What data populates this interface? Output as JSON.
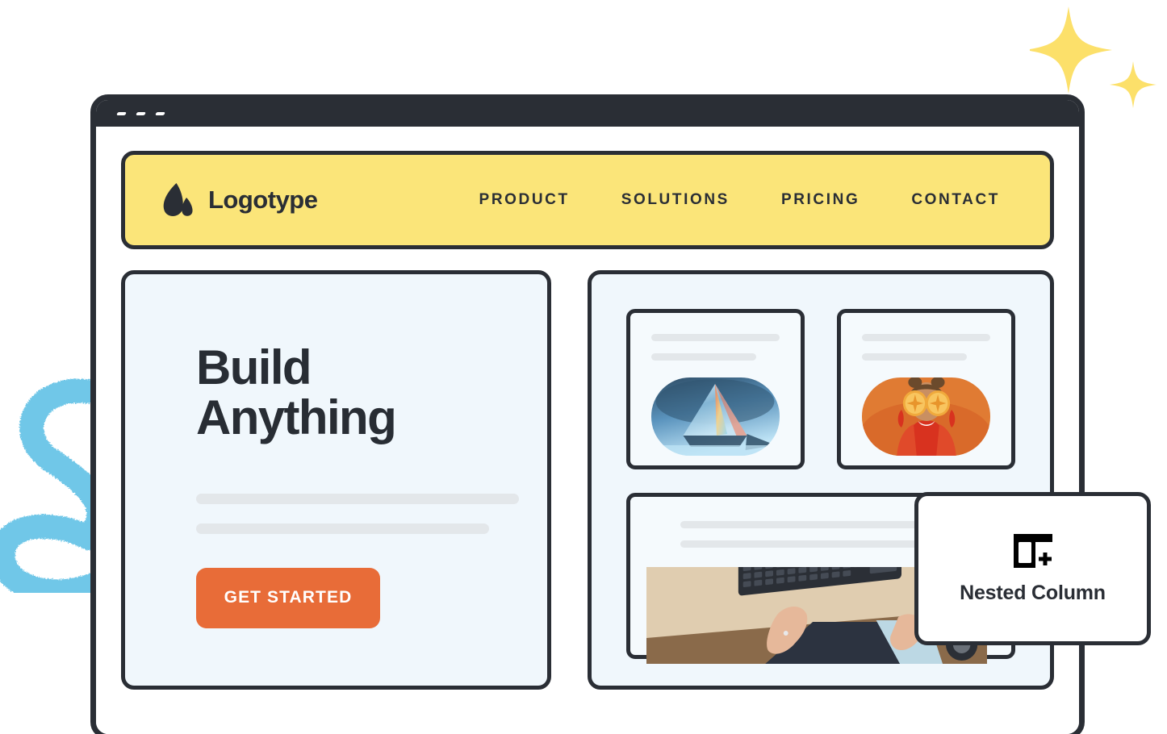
{
  "window": {
    "titlebar_dots": [
      "dot-1",
      "dot-2",
      "dot-3"
    ]
  },
  "nav": {
    "logo_icon": "atlassian-a-logo-icon",
    "brand": "Logotype",
    "links": [
      {
        "label": "PRODUCT"
      },
      {
        "label": "SOLUTIONS"
      },
      {
        "label": "PRICING"
      },
      {
        "label": "CONTACT"
      }
    ],
    "background_color": "#fbe579"
  },
  "hero": {
    "headline_line1": "Build",
    "headline_line2": "Anything",
    "placeholder_bars": 2,
    "cta_label": "GET STARTED",
    "cta_color": "#e86c38",
    "panel_color": "#f0f7fc"
  },
  "content": {
    "panel_color": "#f0f7fc",
    "cards": [
      {
        "name": "card-prism",
        "image": "glass-prism-photo",
        "bars": 2
      },
      {
        "name": "card-oranges",
        "image": "woman-with-oranges-photo",
        "bars": 2
      },
      {
        "name": "card-keyboard",
        "image": "hands-on-keyboard-desk-photo",
        "bars": 2
      }
    ]
  },
  "tooltip": {
    "icon": "nested-column-add-icon",
    "label": "Nested Column"
  },
  "decorations": {
    "squiggle": {
      "name": "blue-brush-squiggle",
      "color": "#6fc7e8"
    },
    "sparkles": {
      "name": "yellow-sparkle-stars",
      "color": "#fce06a",
      "count": 2
    }
  },
  "theme": {
    "outline": "#2a2e35",
    "surface": "#ffffff",
    "panel": "#f0f7fc",
    "bar": "#e3e7ea"
  }
}
